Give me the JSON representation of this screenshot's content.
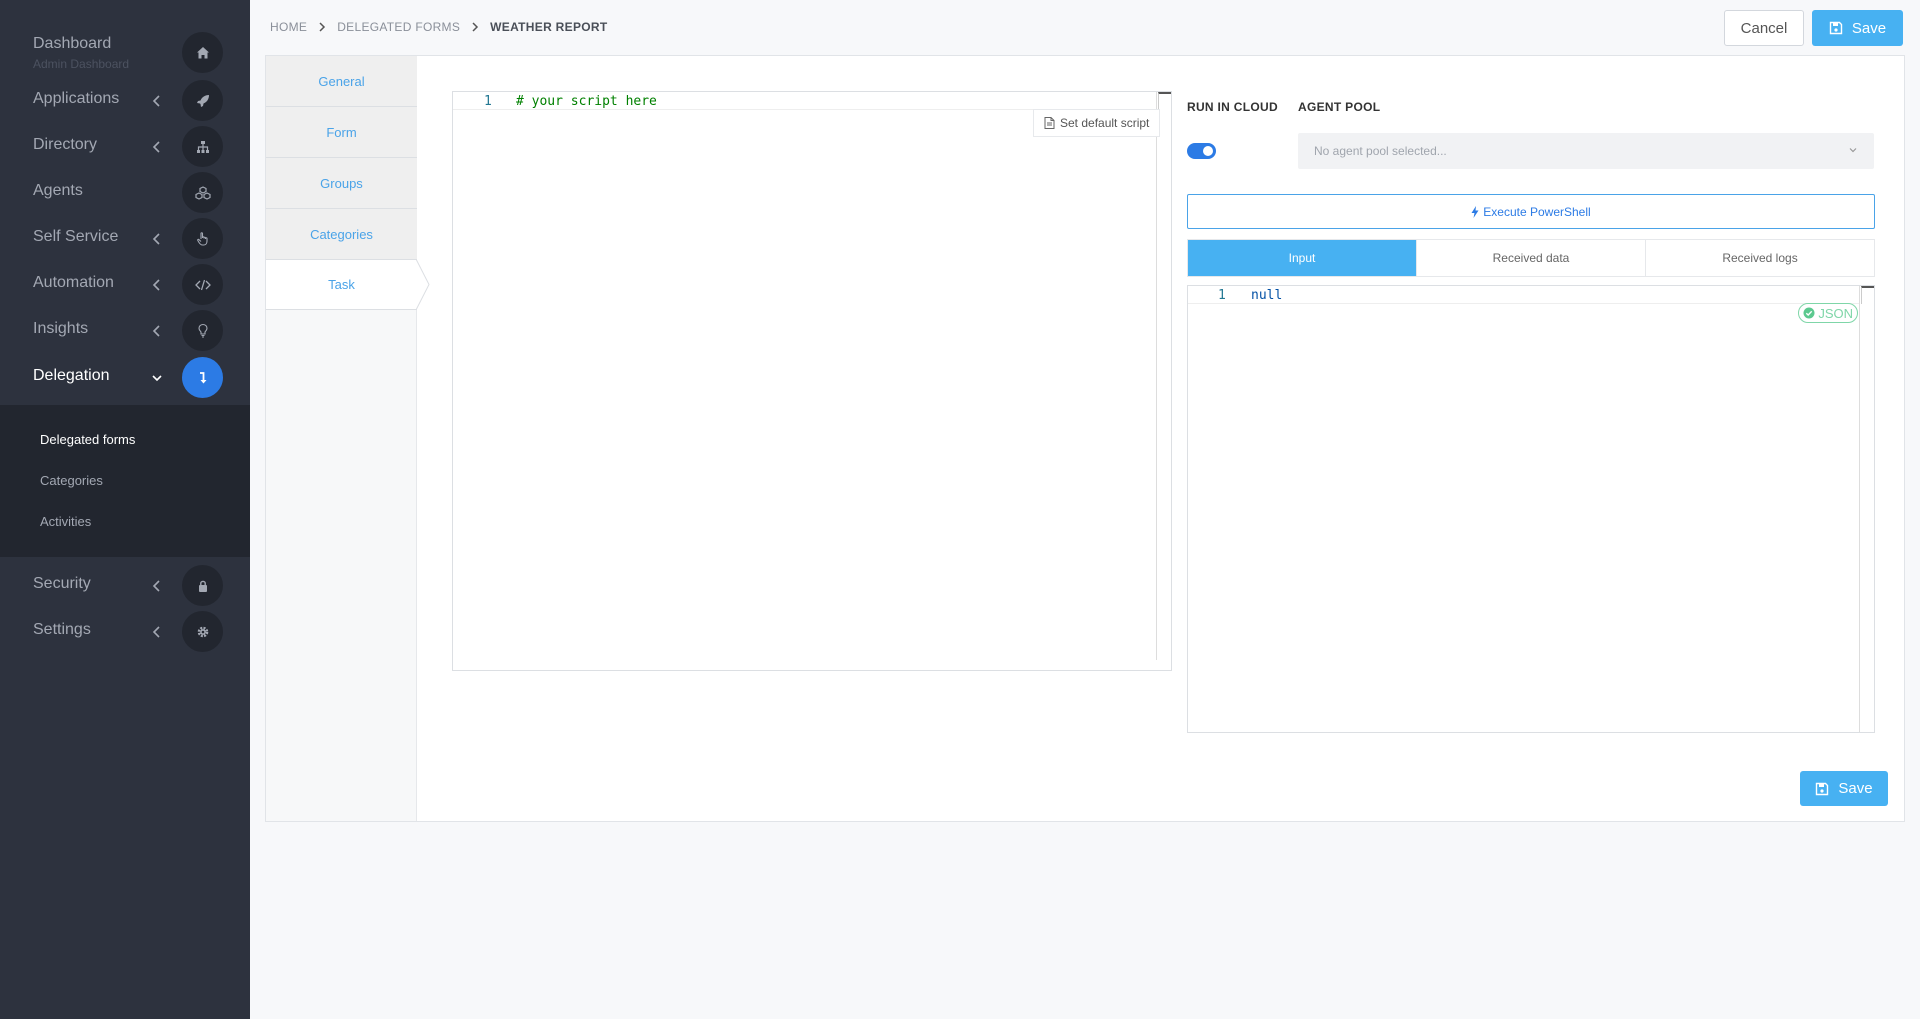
{
  "sidebar": {
    "dashboard": {
      "label": "Dashboard",
      "sublabel": "Admin Dashboard",
      "icon": "home-icon"
    },
    "items": [
      {
        "label": "Applications",
        "icon": "rocket-icon"
      },
      {
        "label": "Directory",
        "icon": "sitemap-icon"
      },
      {
        "label": "Agents",
        "icon": "cubes-icon"
      },
      {
        "label": "Self Service",
        "icon": "hand-pointer-icon"
      },
      {
        "label": "Automation",
        "icon": "code-icon"
      },
      {
        "label": "Insights",
        "icon": "lightbulb-icon"
      },
      {
        "label": "Delegation",
        "icon": "level-down-icon"
      },
      {
        "label": "Security",
        "icon": "lock-icon"
      },
      {
        "label": "Settings",
        "icon": "gear-icon"
      }
    ],
    "submenu": [
      "Delegated forms",
      "Categories",
      "Activities"
    ]
  },
  "breadcrumb": [
    "HOME",
    "DELEGATED FORMS",
    "WEATHER REPORT"
  ],
  "header": {
    "cancel_label": "Cancel",
    "save_label": "Save"
  },
  "tabs": [
    "General",
    "Form",
    "Groups",
    "Categories",
    "Task"
  ],
  "active_tab": "Task",
  "script_editor": {
    "line_number": "1",
    "code": "# your script here",
    "set_default_label": "Set default script"
  },
  "run_in_cloud": {
    "label": "RUN IN CLOUD",
    "enabled": true
  },
  "agent_pool": {
    "label": "AGENT POOL",
    "placeholder": "No agent pool selected..."
  },
  "execute_label": "Execute PowerShell",
  "io_tabs": [
    "Input",
    "Received data",
    "Received logs"
  ],
  "json_editor": {
    "line_number": "1",
    "code": "null",
    "badge": "JSON"
  },
  "footer": {
    "save_label": "Save"
  },
  "colors": {
    "accent": "#2c7be5",
    "save": "#47b1f2",
    "sidebar": "#2d323e"
  }
}
